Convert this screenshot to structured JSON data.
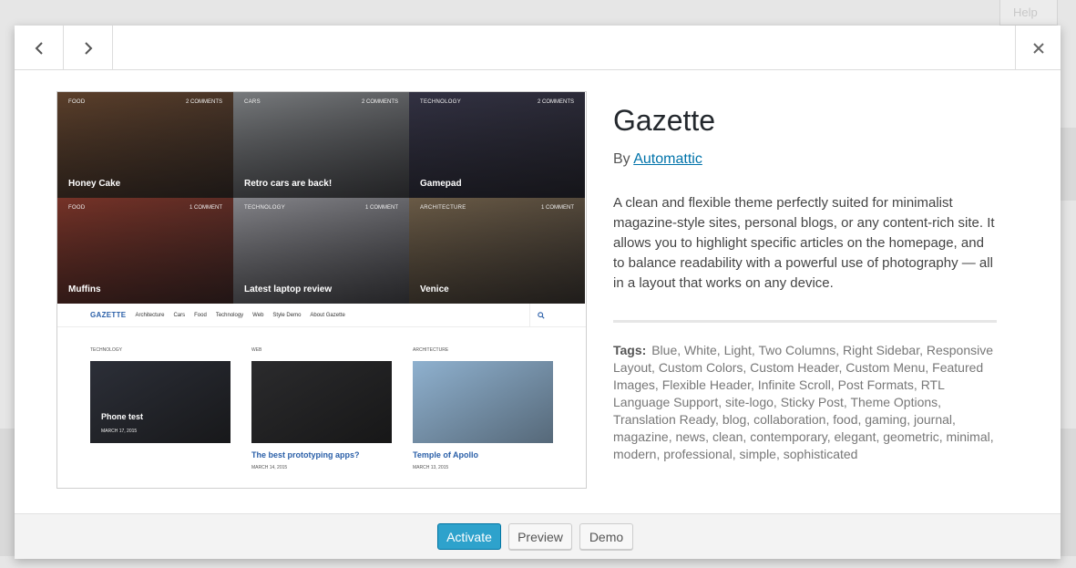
{
  "background": {
    "help_label": "Help"
  },
  "header": {
    "prev_icon": "chevron-left-icon",
    "next_icon": "chevron-right-icon",
    "close_icon": "close-icon"
  },
  "screenshot": {
    "tiles": [
      {
        "category": "FOOD",
        "comments": "2 COMMENTS",
        "title": "Honey Cake",
        "color": "#6b4a32"
      },
      {
        "category": "CARS",
        "comments": "2 COMMENTS",
        "title": "Retro cars are back!",
        "color": "#8c8f92"
      },
      {
        "category": "TECHNOLOGY",
        "comments": "2 COMMENTS",
        "title": "Gamepad",
        "color": "#3b3a4e"
      },
      {
        "category": "FOOD",
        "comments": "1 COMMENT",
        "title": "Muffins",
        "color": "#8a3b2e"
      },
      {
        "category": "TECHNOLOGY",
        "comments": "1 COMMENT",
        "title": "Latest laptop review",
        "color": "#9a9aa0"
      },
      {
        "category": "ARCHITECTURE",
        "comments": "1 COMMENT",
        "title": "Venice",
        "color": "#7c6a52"
      }
    ],
    "site_logo": "GAZETTE",
    "site_menu": [
      "Architecture",
      "Cars",
      "Food",
      "Technology",
      "Web",
      "Style Demo",
      "About Gazette"
    ],
    "posts": [
      {
        "category": "TECHNOLOGY",
        "title": "Phone test",
        "date": "MARCH 17, 2015",
        "color": "#2c2f38"
      },
      {
        "category": "WEB",
        "title": "The best prototyping apps?",
        "date": "MARCH 14, 2015",
        "color": "#2b2b2d"
      },
      {
        "category": "ARCHITECTURE",
        "title": "Temple of Apollo",
        "date": "MARCH 13, 2015",
        "color": "#8fb1cf"
      }
    ]
  },
  "theme": {
    "name": "Gazette",
    "by_label": "By",
    "author": "Automattic",
    "description": "A clean and flexible theme perfectly suited for minimalist magazine-style sites, personal blogs, or any content-rich site. It allows you to highlight specific articles on the homepage, and to balance readability with a powerful use of photography — all in a layout that works on any device.",
    "tags_label": "Tags:",
    "tags": "Blue, White, Light, Two Columns, Right Sidebar, Responsive Layout, Custom Colors, Custom Header, Custom Menu, Featured Images, Flexible Header, Infinite Scroll, Post Formats, RTL Language Support, site-logo, Sticky Post, Theme Options, Translation Ready, blog, collaboration, food, gaming, journal, magazine, news, clean, contemporary, elegant, geometric, minimal, modern, professional, simple, sophisticated"
  },
  "footer": {
    "activate_label": "Activate",
    "preview_label": "Preview",
    "demo_label": "Demo"
  },
  "colors": {
    "accent": "#2ea2cc",
    "link": "#0073aa"
  }
}
